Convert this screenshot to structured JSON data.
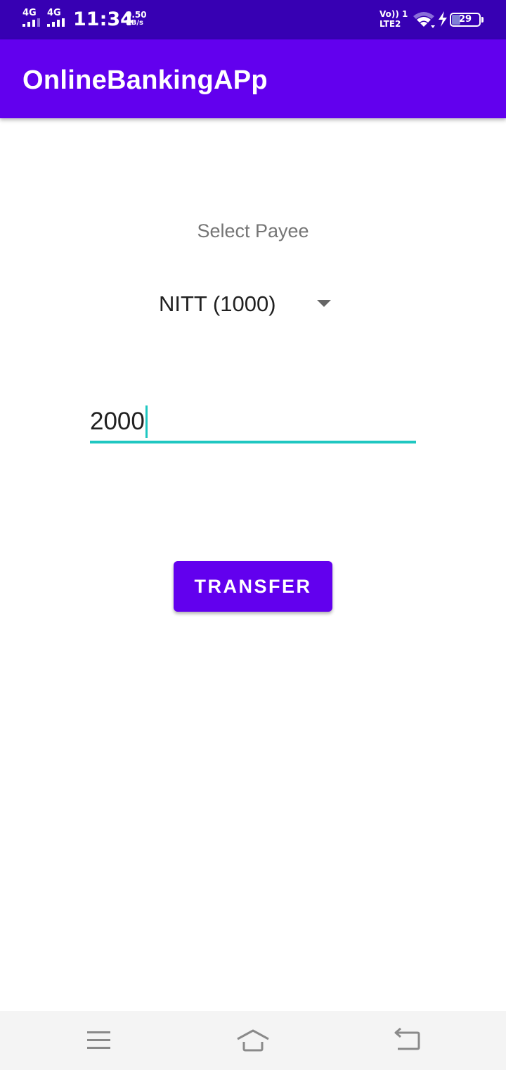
{
  "status_bar": {
    "network_1": "4G",
    "network_2": "4G",
    "time": "11:34",
    "speed_value": "0.50",
    "speed_unit": "KB/s",
    "volte_line1": "Vo)) 1",
    "volte_line2": "LTE2",
    "battery_level": "29",
    "battery_fraction": 0.29
  },
  "app_bar": {
    "title": "OnlineBankingAPp",
    "color": "#6200ee"
  },
  "payee": {
    "label": "Select Payee",
    "selected": "NITT (1000)"
  },
  "amount": {
    "value": "2000",
    "accent_color": "#1fc7c1"
  },
  "transfer": {
    "label": "TRANSFER",
    "color": "#6200ee"
  },
  "nav_bar": {
    "menu_icon": "menu-icon",
    "home_icon": "home-icon",
    "back_icon": "back-icon"
  }
}
